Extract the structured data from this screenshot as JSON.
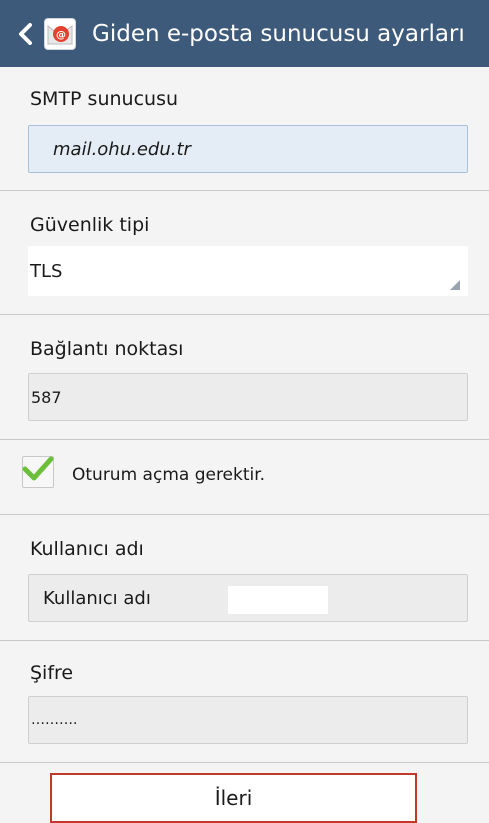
{
  "header": {
    "title": "Giden e-posta sunucusu ayarları",
    "back_icon": "chevron-left-icon",
    "app_icon": "email-app-icon",
    "bar_color": "#3e5a7b"
  },
  "fields": {
    "smtp": {
      "label": "SMTP sunucusu",
      "value": "mail.ohu.edu.tr"
    },
    "security": {
      "label": "Güvenlik tipi",
      "value": "TLS"
    },
    "port": {
      "label": "Bağlantı noktası",
      "value": "587"
    },
    "username": {
      "label": "Kullanıcı adı",
      "value": "Kullanıcı adı"
    },
    "password": {
      "label": "Şifre",
      "value": "………."
    }
  },
  "auth": {
    "label": "Oturum açma gerektir.",
    "checked": true,
    "check_color": "#6cbf3a"
  },
  "actions": {
    "next_label": "İleri",
    "button_border": "#c0392b"
  }
}
